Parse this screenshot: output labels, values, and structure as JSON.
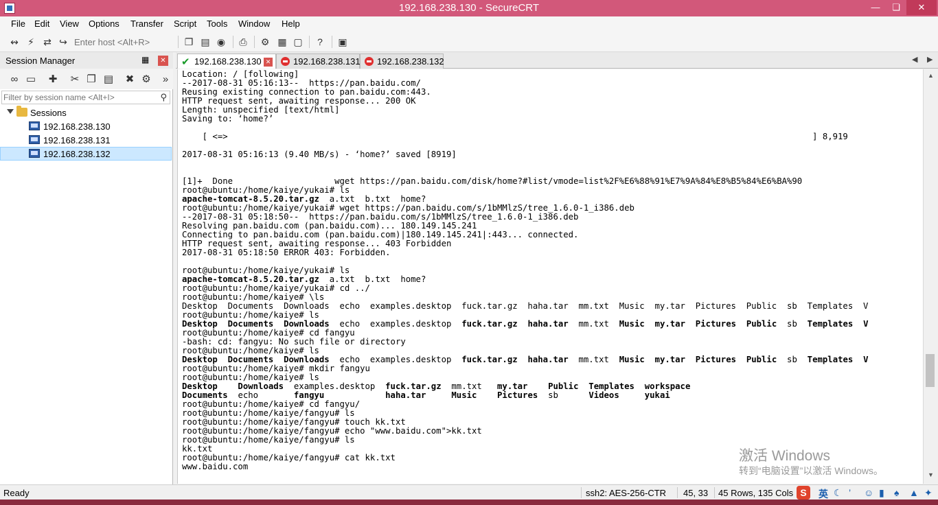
{
  "window": {
    "title": "192.168.238.130 - SecureCRT"
  },
  "menu": [
    "File",
    "Edit",
    "View",
    "Options",
    "Transfer",
    "Script",
    "Tools",
    "Window",
    "Help"
  ],
  "toolbar": {
    "host_placeholder": "Enter host <Alt+R>"
  },
  "session_manager": {
    "title": "Session Manager",
    "filter_placeholder": "Filter by session name <Alt+I>",
    "root": "Sessions",
    "sessions": [
      "192.168.238.130",
      "192.168.238.131",
      "192.168.238.132"
    ],
    "selected": "192.168.238.132"
  },
  "tabs": [
    {
      "label": "192.168.238.130",
      "state": "connected",
      "active": true
    },
    {
      "label": "192.168.238.131",
      "state": "disconnected",
      "active": false
    },
    {
      "label": "192.168.238.132",
      "state": "disconnected",
      "active": false
    }
  ],
  "terminal": {
    "lines": [
      {
        "text": "Location: / [following]",
        "bold": false
      },
      {
        "text": "--2017-08-31 05:16:13--  https://pan.baidu.com/",
        "bold": false
      },
      {
        "text": "Reusing existing connection to pan.baidu.com:443.",
        "bold": false
      },
      {
        "text": "HTTP request sent, awaiting response... 200 OK",
        "bold": false
      },
      {
        "text": "Length: unspecified [text/html]",
        "bold": false
      },
      {
        "text": "Saving to: ‘home?’",
        "bold": false
      },
      {
        "text": "",
        "bold": false
      },
      {
        "text": "    [ <=>                                                                                                                   ] 8,919",
        "bold": false
      },
      {
        "text": "",
        "bold": false
      },
      {
        "text": "2017-08-31 05:16:13 (9.40 MB/s) - ‘home?’ saved [8919]",
        "bold": false
      },
      {
        "text": "",
        "bold": false
      },
      {
        "text": "",
        "bold": false
      },
      {
        "text": "[1]+  Done                    wget https://pan.baidu.com/disk/home?#list/vmode=list%2F%E6%88%91%E7%9A%84%E8%B5%84%E6%BA%90",
        "bold": false
      },
      {
        "text": "root@ubuntu:/home/kaiye/yukai# ls",
        "bold": false
      },
      {
        "segments": [
          [
            "apache-tomcat-8.5.20.tar.gz",
            true
          ],
          [
            "  a.txt  b.txt  home?",
            false
          ]
        ]
      },
      {
        "text": "root@ubuntu:/home/kaiye/yukai# wget https://pan.baidu.com/s/1bMMlzS/tree_1.6.0-1_i386.deb",
        "bold": false
      },
      {
        "text": "--2017-08-31 05:18:50--  https://pan.baidu.com/s/1bMMlzS/tree_1.6.0-1_i386.deb",
        "bold": false
      },
      {
        "text": "Resolving pan.baidu.com (pan.baidu.com)... 180.149.145.241",
        "bold": false
      },
      {
        "text": "Connecting to pan.baidu.com (pan.baidu.com)|180.149.145.241|:443... connected.",
        "bold": false
      },
      {
        "text": "HTTP request sent, awaiting response... 403 Forbidden",
        "bold": false
      },
      {
        "text": "2017-08-31 05:18:50 ERROR 403: Forbidden.",
        "bold": false
      },
      {
        "text": "",
        "bold": false
      },
      {
        "text": "root@ubuntu:/home/kaiye/yukai# ls",
        "bold": false
      },
      {
        "segments": [
          [
            "apache-tomcat-8.5.20.tar.gz",
            true
          ],
          [
            "  a.txt  b.txt  home?",
            false
          ]
        ]
      },
      {
        "text": "root@ubuntu:/home/kaiye/yukai# cd ../",
        "bold": false
      },
      {
        "text": "root@ubuntu:/home/kaiye# \\ls",
        "bold": false
      },
      {
        "text": "Desktop  Documents  Downloads  echo  examples.desktop  fuck.tar.gz  haha.tar  mm.txt  Music  my.tar  Pictures  Public  sb  Templates  V",
        "bold": false
      },
      {
        "text": "root@ubuntu:/home/kaiye# ls",
        "bold": false
      },
      {
        "segments": [
          [
            "Desktop  Documents  Downloads",
            true
          ],
          [
            "  echo  examples.desktop  ",
            false
          ],
          [
            "fuck.tar.gz  haha.tar",
            true
          ],
          [
            "  mm.txt  ",
            false
          ],
          [
            "Music  my.tar  Pictures  Public",
            true
          ],
          [
            "  sb  ",
            false
          ],
          [
            "Templates  V",
            true
          ]
        ]
      },
      {
        "text": "root@ubuntu:/home/kaiye# cd fangyu",
        "bold": false
      },
      {
        "text": "-bash: cd: fangyu: No such file or directory",
        "bold": false
      },
      {
        "text": "root@ubuntu:/home/kaiye# ls",
        "bold": false
      },
      {
        "segments": [
          [
            "Desktop  Documents  Downloads",
            true
          ],
          [
            "  echo  examples.desktop  ",
            false
          ],
          [
            "fuck.tar.gz  haha.tar",
            true
          ],
          [
            "  mm.txt  ",
            false
          ],
          [
            "Music  my.tar  Pictures  Public",
            true
          ],
          [
            "  sb  ",
            false
          ],
          [
            "Templates  V",
            true
          ]
        ]
      },
      {
        "text": "root@ubuntu:/home/kaiye# mkdir fangyu",
        "bold": false
      },
      {
        "text": "root@ubuntu:/home/kaiye# ls",
        "bold": false
      },
      {
        "segments": [
          [
            "Desktop    Downloads",
            true
          ],
          [
            "  examples.desktop  ",
            false
          ],
          [
            "fuck.tar.gz",
            true
          ],
          [
            "  mm.txt   ",
            false
          ],
          [
            "my.tar    Public  Templates  workspace",
            true
          ]
        ]
      },
      {
        "segments": [
          [
            "Documents",
            true
          ],
          [
            "  echo       ",
            false
          ],
          [
            "fangyu",
            true
          ],
          [
            "            ",
            false
          ],
          [
            "haha.tar     Music    Pictures",
            true
          ],
          [
            "  sb      ",
            false
          ],
          [
            "Videos     yukai",
            true
          ]
        ]
      },
      {
        "text": "root@ubuntu:/home/kaiye# cd fangyu/",
        "bold": false
      },
      {
        "text": "root@ubuntu:/home/kaiye/fangyu# ls",
        "bold": false
      },
      {
        "text": "root@ubuntu:/home/kaiye/fangyu# touch kk.txt",
        "bold": false
      },
      {
        "text": "root@ubuntu:/home/kaiye/fangyu# echo \"www.baidu.com\">kk.txt",
        "bold": false
      },
      {
        "text": "root@ubuntu:/home/kaiye/fangyu# ls",
        "bold": false
      },
      {
        "text": "kk.txt",
        "bold": false
      },
      {
        "text": "root@ubuntu:/home/kaiye/fangyu# cat kk.txt",
        "bold": false
      },
      {
        "text": "www.baidu.com",
        "bold": false
      }
    ]
  },
  "watermark": {
    "line1": "激活 Windows",
    "line2": "转到“电脑设置”以激活 Windows。"
  },
  "status": {
    "ready": "Ready",
    "cipher": "ssh2: AES-256-CTR",
    "cursor": "45,  33",
    "size": "45 Rows, 135 Cols"
  },
  "ime": {
    "logo": "S",
    "lang": "英"
  }
}
